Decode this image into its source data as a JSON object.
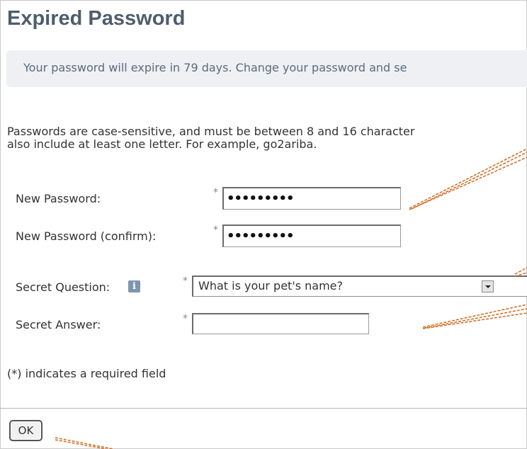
{
  "page": {
    "title": "Expired Password",
    "banner": "Your password will expire in 79 days.  Change your password and se",
    "rules_line1": "Passwords are case-sensitive, and must be between 8 and 16 character",
    "rules_line2": "also include at least one letter. For example, go2ariba."
  },
  "form": {
    "new_password_label": "New Password:",
    "new_password_value": "•••••••••",
    "confirm_password_label": "New Password (confirm):",
    "confirm_password_value": "•••••••••",
    "secret_question_label": "Secret Question:",
    "secret_question_selected": "What is your pet's name?",
    "secret_answer_label": "Secret Answer:",
    "secret_answer_value": "",
    "required_marker": "*",
    "required_note": "(*) indicates a required field",
    "info_icon": "info-icon"
  },
  "actions": {
    "ok_label": "OK"
  },
  "colors": {
    "title": "#4e5d6e",
    "banner_bg": "#eef0f3",
    "banner_text": "#5a6b7d",
    "callout": "#d2691e"
  }
}
